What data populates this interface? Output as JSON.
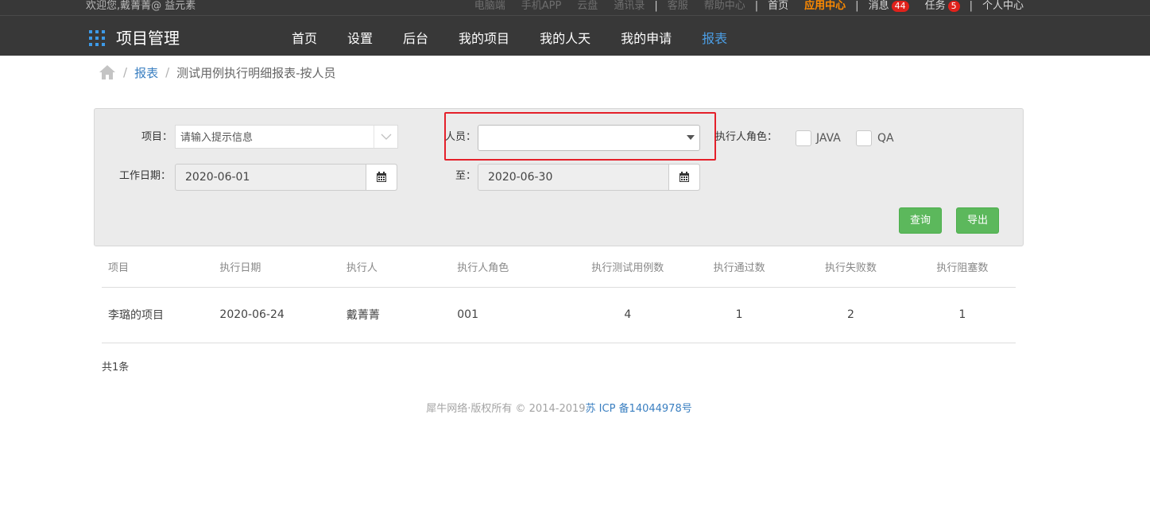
{
  "header": {
    "welcome": "欢迎您,戴菁菁@ 益元素",
    "links": {
      "pc": "电脑端",
      "app": "手机APP",
      "cloud": "云盘",
      "contacts": "通讯录",
      "service": "客服",
      "help": "帮助中心",
      "home": "首页",
      "app_center": "应用中心",
      "messages": "消息",
      "messages_count": "44",
      "tasks": "任务",
      "tasks_count": "5",
      "personal": "个人中心"
    },
    "separator": "|",
    "brand": "项目管理",
    "nav": [
      "首页",
      "设置",
      "后台",
      "我的项目",
      "我的人天",
      "我的申请",
      "报表"
    ],
    "active_nav": "报表"
  },
  "breadcrumb": {
    "sep": "/",
    "link": "报表",
    "current": "测试用例执行明细报表-按人员"
  },
  "filter": {
    "project_label": "项目：",
    "project_placeholder": "请输入提示信息",
    "person_label": "人员：",
    "person_value": "",
    "role_label": "执行人角色：",
    "roles": [
      "JAVA",
      "QA"
    ],
    "date_label": "工作日期：",
    "date_from": "2020-06-01",
    "to_label": "至：",
    "date_to": "2020-06-30",
    "query_button": "查询",
    "export_button": "导出"
  },
  "table": {
    "headers": [
      "项目",
      "执行日期",
      "执行人",
      "执行人角色",
      "执行测试用例数",
      "执行通过数",
      "执行失败数",
      "执行阻塞数"
    ],
    "rows": [
      [
        "李璐的项目",
        "2020-06-24",
        "戴菁菁",
        "001",
        "4",
        "1",
        "2",
        "1"
      ]
    ]
  },
  "total": "共1条",
  "footer": {
    "copyright": "犀牛网络·版权所有 © 2014-2019",
    "icp": "苏 ICP 备14044978号"
  },
  "colors": {
    "topbar": "#383838",
    "accent_blue": "#4c9ee5",
    "app_center": "#ff8a00",
    "badge": "#e0211b",
    "button_green": "#5cb85c",
    "highlight_red": "#e4202a"
  }
}
